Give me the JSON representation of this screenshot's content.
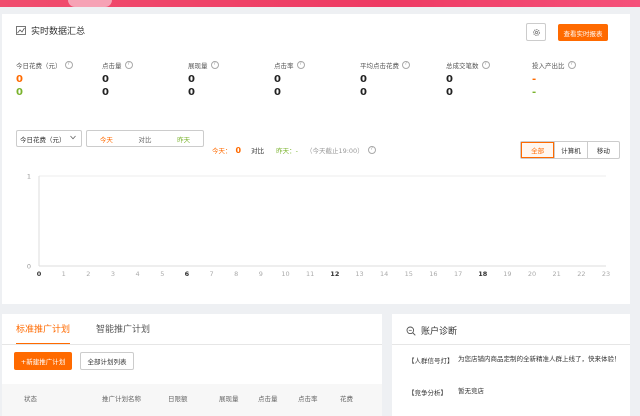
{
  "header": {
    "title": "实时数据汇总",
    "report_button": "查看实时报表"
  },
  "metrics": [
    {
      "label": "今日花费（元）",
      "today": "0",
      "yesterday": "0",
      "today_color": "#ff6a00",
      "yesterday_color": "#7ab32d"
    },
    {
      "label": "点击量",
      "today": "0",
      "yesterday": "0",
      "today_color": "#222",
      "yesterday_color": "#222"
    },
    {
      "label": "展现量",
      "today": "0",
      "yesterday": "0",
      "today_color": "#222",
      "yesterday_color": "#222"
    },
    {
      "label": "点击率",
      "today": "0",
      "yesterday": "0",
      "today_color": "#222",
      "yesterday_color": "#222"
    },
    {
      "label": "平均点击花费",
      "today": "0",
      "yesterday": "0",
      "today_color": "#222",
      "yesterday_color": "#222"
    },
    {
      "label": "总成交笔数",
      "today": "0",
      "yesterday": "0",
      "today_color": "#222",
      "yesterday_color": "#222"
    },
    {
      "label": "投入产出比",
      "today": "-",
      "yesterday": "-",
      "today_color": "#ff6a00",
      "yesterday_color": "#7ab32d"
    }
  ],
  "filter": {
    "select_value": "今日花费（元）",
    "segment": {
      "today": "今天",
      "vs": "对比",
      "yesterday": "昨天"
    },
    "compare": {
      "today_label": "今天：",
      "today_value": "0",
      "vs_label": "对比",
      "yesterday_label": "昨天：-",
      "note": "（今天截止19:00）"
    }
  },
  "device_tabs": [
    "全部",
    "计算机",
    "移动"
  ],
  "chart_data": {
    "type": "line",
    "x": [
      0,
      1,
      2,
      3,
      4,
      5,
      6,
      7,
      8,
      9,
      10,
      11,
      12,
      13,
      14,
      15,
      16,
      17,
      18,
      19,
      20,
      21,
      22,
      23
    ],
    "y_ticks": [
      "1",
      "0"
    ],
    "ylim": [
      0,
      1
    ],
    "bold_x": [
      0,
      6,
      12,
      18
    ],
    "series": [],
    "grid": true
  },
  "plans": {
    "tabs": [
      "标准推广计划",
      "智能推广计划"
    ],
    "new_button": "+新建推广计划",
    "list_button": "全部计划列表",
    "columns": [
      "状态",
      "推广计划名称",
      "日限额",
      "展现量",
      "点击量",
      "点击率",
      "花费"
    ]
  },
  "diagnosis": {
    "title": "账户诊断",
    "rows": [
      {
        "key": "【人群信号灯】",
        "value": "为您店铺内商品定制的全新精准人群上线了，快来体验！"
      },
      {
        "key": "【竞争分析】",
        "value": "暂无竞店"
      }
    ]
  },
  "colors": {
    "accent": "#ff6a00",
    "green": "#7ab32d",
    "banner": "#ee3a63"
  },
  "icons": {
    "title_icon": "line-chart-icon",
    "settings": "gear-icon",
    "help": "question-circle-icon",
    "diagnosis": "search-doc-icon"
  }
}
